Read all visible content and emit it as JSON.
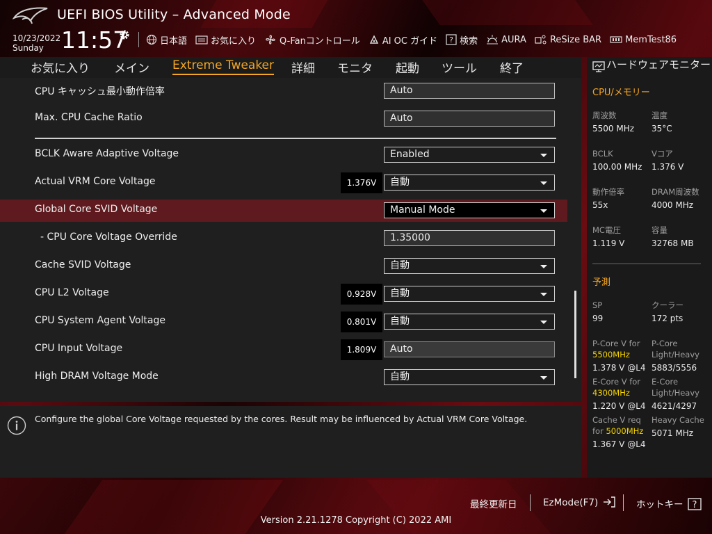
{
  "header": {
    "title": "UEFI BIOS Utility – Advanced Mode",
    "date": "10/23/2022",
    "day": "Sunday",
    "time": "11:57"
  },
  "toolbar": [
    {
      "label": "日本語",
      "icon": "globe-icon"
    },
    {
      "label": "お気に入り",
      "icon": "favorites-icon"
    },
    {
      "label": "Q-Fanコントロール",
      "icon": "fan-icon"
    },
    {
      "label": "AI OC ガイド",
      "icon": "ai-oc-icon"
    },
    {
      "label": "検索",
      "icon": "help-icon"
    },
    {
      "label": "AURA",
      "icon": "aura-icon"
    },
    {
      "label": "ReSize BAR",
      "icon": "resize-bar-icon"
    },
    {
      "label": "MemTest86",
      "icon": "memtest-icon"
    }
  ],
  "tabs": [
    {
      "label": "お気に入り"
    },
    {
      "label": "メイン"
    },
    {
      "label": "Extreme Tweaker"
    },
    {
      "label": "詳細"
    },
    {
      "label": "モニタ"
    },
    {
      "label": "起動"
    },
    {
      "label": "ツール"
    },
    {
      "label": "終了"
    }
  ],
  "active_tab": "Extreme Tweaker",
  "settings": [
    {
      "label": "CPU キャッシュ最小動作倍率",
      "value": "Auto",
      "type": "text"
    },
    {
      "label": "Max. CPU Cache Ratio",
      "value": "Auto",
      "type": "text"
    },
    {
      "label": "BCLK Aware Adaptive Voltage",
      "value": "Enabled",
      "type": "select"
    },
    {
      "label": "Actual VRM Core Voltage",
      "voltage": "1.376V",
      "value": "自動",
      "type": "select"
    },
    {
      "label": "Global Core SVID Voltage",
      "value": "Manual Mode",
      "type": "select",
      "selected": true
    },
    {
      "label": "- CPU Core Voltage Override",
      "value": "1.35000",
      "type": "text"
    },
    {
      "label": "Cache SVID Voltage",
      "value": "自動",
      "type": "select"
    },
    {
      "label": "CPU L2 Voltage",
      "voltage": "0.928V",
      "value": "自動",
      "type": "select"
    },
    {
      "label": "CPU System Agent Voltage",
      "voltage": "0.801V",
      "value": "自動",
      "type": "select"
    },
    {
      "label": "CPU Input Voltage",
      "voltage": "1.809V",
      "value": "Auto",
      "type": "readonly"
    },
    {
      "label": "High DRAM Voltage Mode",
      "value": "自動",
      "type": "select"
    }
  ],
  "help_text": "Configure the global Core Voltage requested by the cores. Result may be influenced by Actual VRM Core Voltage.",
  "hw_monitor": {
    "title": "ハードウェアモニター",
    "section_cpu": "CPU/メモリー",
    "cpu_items": [
      {
        "label": "周波数",
        "value": "5500 MHz"
      },
      {
        "label": "温度",
        "value": "35°C"
      },
      {
        "label": "BCLK",
        "value": "100.00 MHz"
      },
      {
        "label": "Vコア",
        "value": "1.376 V"
      },
      {
        "label": "動作倍率",
        "value": "55x"
      },
      {
        "label": "DRAM周波数",
        "value": "4000 MHz"
      },
      {
        "label": "MC電圧",
        "value": "1.119 V"
      },
      {
        "label": "容量",
        "value": "32768 MB"
      }
    ],
    "section_predict": "予測",
    "sp_label": "SP",
    "sp_value": "99",
    "cooler_label": "クーラー",
    "cooler_value": "172 pts",
    "pcore_v_label": "P-Core V for",
    "pcore_v_freq": "5500MHz",
    "pcore_v_value": "1.378 V @L4",
    "pcore_lh_label1": "P-Core",
    "pcore_lh_label2": "Light/Heavy",
    "pcore_lh_value": "5883/5556",
    "ecore_v_label": "E-Core V for",
    "ecore_v_freq": "4300MHz",
    "ecore_v_value": "1.220 V @L4",
    "ecore_lh_label1": "E-Core",
    "ecore_lh_label2": "Light/Heavy",
    "ecore_lh_value": "4621/4297",
    "cache_v_label1": "Cache V req",
    "cache_v_label2": "for",
    "cache_v_freq": "5000MHz",
    "cache_v_value": "1.367 V @L4",
    "heavy_cache_label": "Heavy Cache",
    "heavy_cache_value": "5071 MHz"
  },
  "footer": {
    "last_modified": "最終更新日",
    "ezmode": "EzMode(F7)",
    "hotkeys": "ホットキー",
    "version": "Version 2.21.1278 Copyright (C) 2022 AMI"
  },
  "colors": {
    "accent": "#f5a623",
    "selected_row": "#5e1a1e",
    "highlight": "#f5d400"
  }
}
